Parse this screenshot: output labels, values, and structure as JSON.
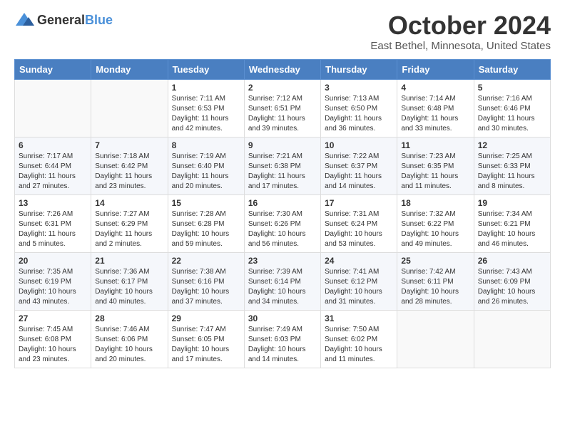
{
  "header": {
    "logo_general": "General",
    "logo_blue": "Blue",
    "title": "October 2024",
    "subtitle": "East Bethel, Minnesota, United States"
  },
  "days_of_week": [
    "Sunday",
    "Monday",
    "Tuesday",
    "Wednesday",
    "Thursday",
    "Friday",
    "Saturday"
  ],
  "weeks": [
    [
      {
        "day": "",
        "sunrise": "",
        "sunset": "",
        "daylight": ""
      },
      {
        "day": "",
        "sunrise": "",
        "sunset": "",
        "daylight": ""
      },
      {
        "day": "1",
        "sunrise": "Sunrise: 7:11 AM",
        "sunset": "Sunset: 6:53 PM",
        "daylight": "Daylight: 11 hours and 42 minutes."
      },
      {
        "day": "2",
        "sunrise": "Sunrise: 7:12 AM",
        "sunset": "Sunset: 6:51 PM",
        "daylight": "Daylight: 11 hours and 39 minutes."
      },
      {
        "day": "3",
        "sunrise": "Sunrise: 7:13 AM",
        "sunset": "Sunset: 6:50 PM",
        "daylight": "Daylight: 11 hours and 36 minutes."
      },
      {
        "day": "4",
        "sunrise": "Sunrise: 7:14 AM",
        "sunset": "Sunset: 6:48 PM",
        "daylight": "Daylight: 11 hours and 33 minutes."
      },
      {
        "day": "5",
        "sunrise": "Sunrise: 7:16 AM",
        "sunset": "Sunset: 6:46 PM",
        "daylight": "Daylight: 11 hours and 30 minutes."
      }
    ],
    [
      {
        "day": "6",
        "sunrise": "Sunrise: 7:17 AM",
        "sunset": "Sunset: 6:44 PM",
        "daylight": "Daylight: 11 hours and 27 minutes."
      },
      {
        "day": "7",
        "sunrise": "Sunrise: 7:18 AM",
        "sunset": "Sunset: 6:42 PM",
        "daylight": "Daylight: 11 hours and 23 minutes."
      },
      {
        "day": "8",
        "sunrise": "Sunrise: 7:19 AM",
        "sunset": "Sunset: 6:40 PM",
        "daylight": "Daylight: 11 hours and 20 minutes."
      },
      {
        "day": "9",
        "sunrise": "Sunrise: 7:21 AM",
        "sunset": "Sunset: 6:38 PM",
        "daylight": "Daylight: 11 hours and 17 minutes."
      },
      {
        "day": "10",
        "sunrise": "Sunrise: 7:22 AM",
        "sunset": "Sunset: 6:37 PM",
        "daylight": "Daylight: 11 hours and 14 minutes."
      },
      {
        "day": "11",
        "sunrise": "Sunrise: 7:23 AM",
        "sunset": "Sunset: 6:35 PM",
        "daylight": "Daylight: 11 hours and 11 minutes."
      },
      {
        "day": "12",
        "sunrise": "Sunrise: 7:25 AM",
        "sunset": "Sunset: 6:33 PM",
        "daylight": "Daylight: 11 hours and 8 minutes."
      }
    ],
    [
      {
        "day": "13",
        "sunrise": "Sunrise: 7:26 AM",
        "sunset": "Sunset: 6:31 PM",
        "daylight": "Daylight: 11 hours and 5 minutes."
      },
      {
        "day": "14",
        "sunrise": "Sunrise: 7:27 AM",
        "sunset": "Sunset: 6:29 PM",
        "daylight": "Daylight: 11 hours and 2 minutes."
      },
      {
        "day": "15",
        "sunrise": "Sunrise: 7:28 AM",
        "sunset": "Sunset: 6:28 PM",
        "daylight": "Daylight: 10 hours and 59 minutes."
      },
      {
        "day": "16",
        "sunrise": "Sunrise: 7:30 AM",
        "sunset": "Sunset: 6:26 PM",
        "daylight": "Daylight: 10 hours and 56 minutes."
      },
      {
        "day": "17",
        "sunrise": "Sunrise: 7:31 AM",
        "sunset": "Sunset: 6:24 PM",
        "daylight": "Daylight: 10 hours and 53 minutes."
      },
      {
        "day": "18",
        "sunrise": "Sunrise: 7:32 AM",
        "sunset": "Sunset: 6:22 PM",
        "daylight": "Daylight: 10 hours and 49 minutes."
      },
      {
        "day": "19",
        "sunrise": "Sunrise: 7:34 AM",
        "sunset": "Sunset: 6:21 PM",
        "daylight": "Daylight: 10 hours and 46 minutes."
      }
    ],
    [
      {
        "day": "20",
        "sunrise": "Sunrise: 7:35 AM",
        "sunset": "Sunset: 6:19 PM",
        "daylight": "Daylight: 10 hours and 43 minutes."
      },
      {
        "day": "21",
        "sunrise": "Sunrise: 7:36 AM",
        "sunset": "Sunset: 6:17 PM",
        "daylight": "Daylight: 10 hours and 40 minutes."
      },
      {
        "day": "22",
        "sunrise": "Sunrise: 7:38 AM",
        "sunset": "Sunset: 6:16 PM",
        "daylight": "Daylight: 10 hours and 37 minutes."
      },
      {
        "day": "23",
        "sunrise": "Sunrise: 7:39 AM",
        "sunset": "Sunset: 6:14 PM",
        "daylight": "Daylight: 10 hours and 34 minutes."
      },
      {
        "day": "24",
        "sunrise": "Sunrise: 7:41 AM",
        "sunset": "Sunset: 6:12 PM",
        "daylight": "Daylight: 10 hours and 31 minutes."
      },
      {
        "day": "25",
        "sunrise": "Sunrise: 7:42 AM",
        "sunset": "Sunset: 6:11 PM",
        "daylight": "Daylight: 10 hours and 28 minutes."
      },
      {
        "day": "26",
        "sunrise": "Sunrise: 7:43 AM",
        "sunset": "Sunset: 6:09 PM",
        "daylight": "Daylight: 10 hours and 26 minutes."
      }
    ],
    [
      {
        "day": "27",
        "sunrise": "Sunrise: 7:45 AM",
        "sunset": "Sunset: 6:08 PM",
        "daylight": "Daylight: 10 hours and 23 minutes."
      },
      {
        "day": "28",
        "sunrise": "Sunrise: 7:46 AM",
        "sunset": "Sunset: 6:06 PM",
        "daylight": "Daylight: 10 hours and 20 minutes."
      },
      {
        "day": "29",
        "sunrise": "Sunrise: 7:47 AM",
        "sunset": "Sunset: 6:05 PM",
        "daylight": "Daylight: 10 hours and 17 minutes."
      },
      {
        "day": "30",
        "sunrise": "Sunrise: 7:49 AM",
        "sunset": "Sunset: 6:03 PM",
        "daylight": "Daylight: 10 hours and 14 minutes."
      },
      {
        "day": "31",
        "sunrise": "Sunrise: 7:50 AM",
        "sunset": "Sunset: 6:02 PM",
        "daylight": "Daylight: 10 hours and 11 minutes."
      },
      {
        "day": "",
        "sunrise": "",
        "sunset": "",
        "daylight": ""
      },
      {
        "day": "",
        "sunrise": "",
        "sunset": "",
        "daylight": ""
      }
    ]
  ]
}
